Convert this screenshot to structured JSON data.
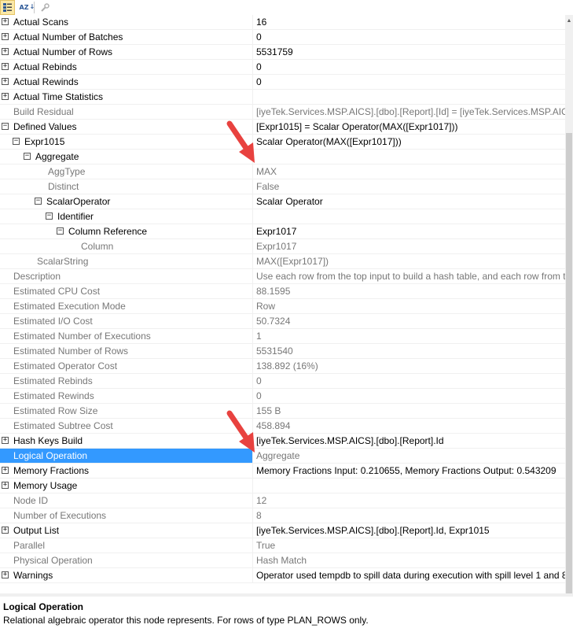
{
  "toolbar": {
    "buttons": [
      {
        "name": "categorized-icon",
        "active": true
      },
      {
        "name": "sort-alphabetical-icon",
        "glyph": "AZ",
        "active": false
      },
      {
        "name": "property-pages-icon",
        "active": false
      }
    ]
  },
  "properties": [
    {
      "name": "Actual Scans",
      "value": "16",
      "indent": 0,
      "expander": "plus",
      "bold": true
    },
    {
      "name": "Actual Number of Batches",
      "value": "0",
      "indent": 0,
      "expander": "plus",
      "bold": true
    },
    {
      "name": "Actual Number of Rows",
      "value": "5531759",
      "indent": 0,
      "expander": "plus",
      "bold": true
    },
    {
      "name": "Actual Rebinds",
      "value": "0",
      "indent": 0,
      "expander": "plus",
      "bold": true
    },
    {
      "name": "Actual Rewinds",
      "value": "0",
      "indent": 0,
      "expander": "plus",
      "bold": true
    },
    {
      "name": "Actual Time Statistics",
      "value": "",
      "indent": 0,
      "expander": "plus",
      "bold": true
    },
    {
      "name": "Build Residual",
      "value": "[iyeTek.Services.MSP.AICS].[dbo].[Report].[Id] = [iyeTek.Services.MSP.AICS",
      "indent": 0,
      "expander": "none",
      "bold": false
    },
    {
      "name": "Defined Values",
      "value": "[Expr1015] = Scalar Operator(MAX([Expr1017]))",
      "indent": 0,
      "expander": "minus",
      "bold": true
    },
    {
      "name": "Expr1015",
      "value": "Scalar Operator(MAX([Expr1017]))",
      "indent": 1,
      "expander": "minus",
      "bold": true
    },
    {
      "name": "Aggregate",
      "value": "",
      "indent": 2,
      "expander": "minus",
      "bold": true
    },
    {
      "name": "AggType",
      "value": "MAX",
      "indent": 3,
      "expander": "none",
      "bold": false
    },
    {
      "name": "Distinct",
      "value": "False",
      "indent": 3,
      "expander": "none",
      "bold": false
    },
    {
      "name": "ScalarOperator",
      "value": "Scalar Operator",
      "indent": 3,
      "expander": "minus",
      "bold": true
    },
    {
      "name": "Identifier",
      "value": "",
      "indent": 4,
      "expander": "minus",
      "bold": true
    },
    {
      "name": "Column Reference",
      "value": "Expr1017",
      "indent": 5,
      "expander": "minus",
      "bold": true
    },
    {
      "name": "Column",
      "value": "Expr1017",
      "indent": 6,
      "expander": "none",
      "bold": false
    },
    {
      "name": "ScalarString",
      "value": "MAX([Expr1017])",
      "indent": 2,
      "expander": "none",
      "bold": false
    },
    {
      "name": "Description",
      "value": "Use each row from the top input to build a hash table, and each row from t",
      "indent": 0,
      "expander": "none",
      "bold": false
    },
    {
      "name": "Estimated CPU Cost",
      "value": "88.1595",
      "indent": 0,
      "expander": "none",
      "bold": false
    },
    {
      "name": "Estimated Execution Mode",
      "value": "Row",
      "indent": 0,
      "expander": "none",
      "bold": false
    },
    {
      "name": "Estimated I/O Cost",
      "value": "50.7324",
      "indent": 0,
      "expander": "none",
      "bold": false
    },
    {
      "name": "Estimated Number of Executions",
      "value": "1",
      "indent": 0,
      "expander": "none",
      "bold": false
    },
    {
      "name": "Estimated Number of Rows",
      "value": "5531540",
      "indent": 0,
      "expander": "none",
      "bold": false
    },
    {
      "name": "Estimated Operator Cost",
      "value": "138.892 (16%)",
      "indent": 0,
      "expander": "none",
      "bold": false
    },
    {
      "name": "Estimated Rebinds",
      "value": "0",
      "indent": 0,
      "expander": "none",
      "bold": false
    },
    {
      "name": "Estimated Rewinds",
      "value": "0",
      "indent": 0,
      "expander": "none",
      "bold": false
    },
    {
      "name": "Estimated Row Size",
      "value": "155 B",
      "indent": 0,
      "expander": "none",
      "bold": false
    },
    {
      "name": "Estimated Subtree Cost",
      "value": "458.894",
      "indent": 0,
      "expander": "none",
      "bold": false
    },
    {
      "name": "Hash Keys Build",
      "value": "[iyeTek.Services.MSP.AICS].[dbo].[Report].Id",
      "indent": 0,
      "expander": "plus",
      "bold": true
    },
    {
      "name": "Logical Operation",
      "value": "Aggregate",
      "indent": 0,
      "expander": "none",
      "bold": false,
      "selected": true
    },
    {
      "name": "Memory Fractions",
      "value": "Memory Fractions Input: 0.210655, Memory Fractions Output: 0.543209",
      "indent": 0,
      "expander": "plus",
      "bold": true
    },
    {
      "name": "Memory Usage",
      "value": "",
      "indent": 0,
      "expander": "plus",
      "bold": true
    },
    {
      "name": "Node ID",
      "value": "12",
      "indent": 0,
      "expander": "none",
      "bold": false
    },
    {
      "name": "Number of Executions",
      "value": "8",
      "indent": 0,
      "expander": "none",
      "bold": false
    },
    {
      "name": "Output List",
      "value": "[iyeTek.Services.MSP.AICS].[dbo].[Report].Id, Expr1015",
      "indent": 0,
      "expander": "plus",
      "bold": true
    },
    {
      "name": "Parallel",
      "value": "True",
      "indent": 0,
      "expander": "none",
      "bold": false
    },
    {
      "name": "Physical Operation",
      "value": "Hash Match",
      "indent": 0,
      "expander": "none",
      "bold": false
    },
    {
      "name": "Warnings",
      "value": "Operator used tempdb to spill data during execution with spill level 1 and 8",
      "indent": 0,
      "expander": "plus",
      "bold": true
    }
  ],
  "description_panel": {
    "title": "Logical Operation",
    "text": "Relational algebraic operator this node represents. For rows of type PLAN_ROWS only."
  },
  "colors": {
    "selection": "#3399ff",
    "readonly_text": "#777777",
    "arrow": "#e8423f"
  },
  "icons": {
    "expand": "plus-box-icon",
    "collapse": "minus-box-icon",
    "annotation": "red-arrow-icon"
  }
}
